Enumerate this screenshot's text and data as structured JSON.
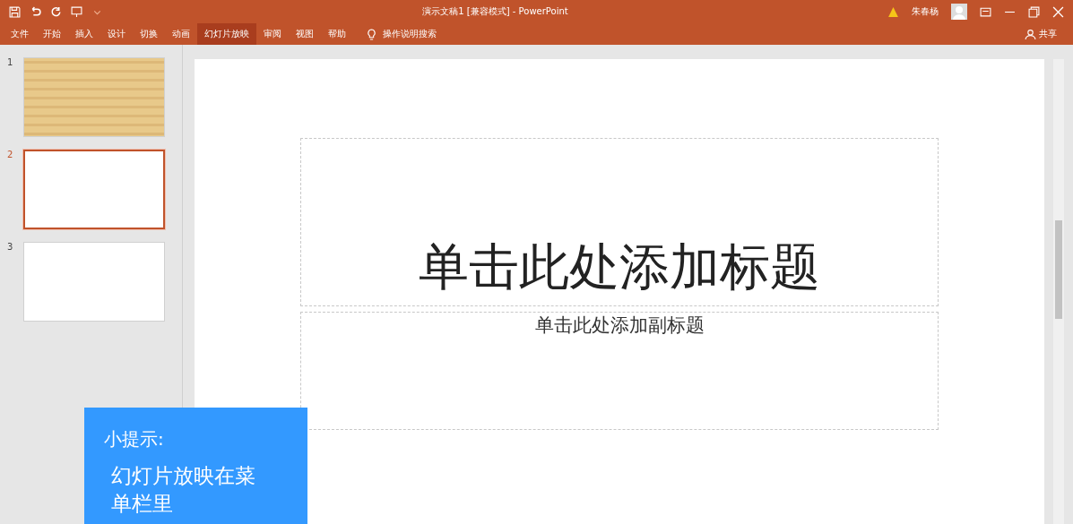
{
  "window": {
    "title": "演示文稿1 [兼容模式] - PowerPoint",
    "user": "朱春杨",
    "share": "共享"
  },
  "tabs": [
    {
      "label": "文件",
      "selected": false
    },
    {
      "label": "开始",
      "selected": false
    },
    {
      "label": "插入",
      "selected": false
    },
    {
      "label": "设计",
      "selected": false
    },
    {
      "label": "切换",
      "selected": false
    },
    {
      "label": "动画",
      "selected": false
    },
    {
      "label": "幻灯片放映",
      "selected": true
    },
    {
      "label": "审阅",
      "selected": false
    },
    {
      "label": "视图",
      "selected": false
    },
    {
      "label": "帮助",
      "selected": false
    }
  ],
  "search": {
    "placeholder": "操作说明搜索"
  },
  "slides": [
    {
      "number": "1",
      "selected": false,
      "kind": "wood"
    },
    {
      "number": "2",
      "selected": true,
      "kind": "blank"
    },
    {
      "number": "3",
      "selected": false,
      "kind": "blank"
    }
  ],
  "slide": {
    "title_placeholder": "单击此处添加标题",
    "subtitle_placeholder": "单击此处添加副标题"
  },
  "tip": {
    "heading": "小提示:",
    "body": "幻灯片放映在菜单栏里"
  }
}
